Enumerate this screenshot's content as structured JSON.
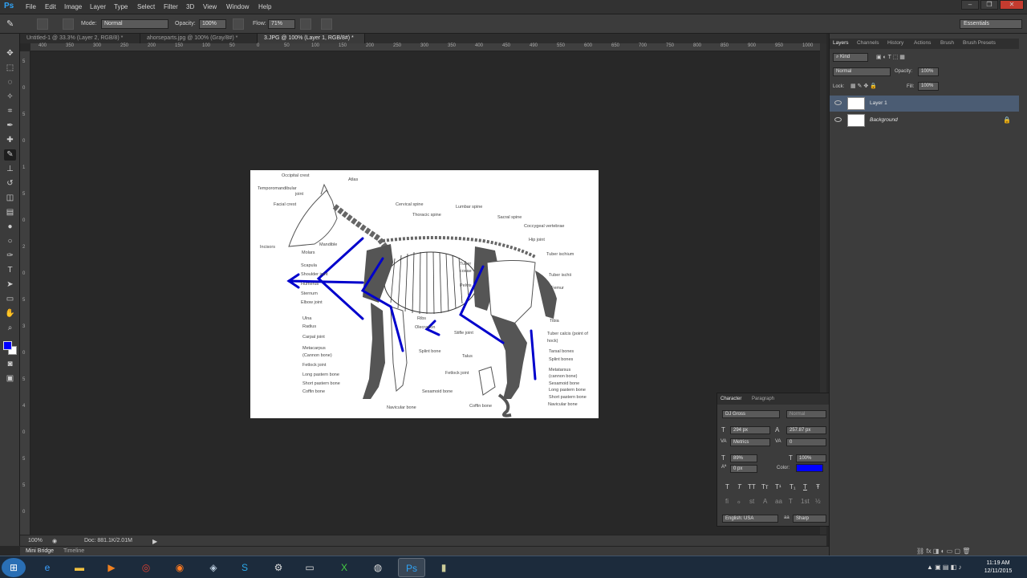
{
  "app": {
    "logo": "Ps"
  },
  "menu": [
    "File",
    "Edit",
    "Image",
    "Layer",
    "Type",
    "Select",
    "Filter",
    "3D",
    "View",
    "Window",
    "Help"
  ],
  "options": {
    "mode_label": "Mode:",
    "mode_value": "Normal",
    "opacity_label": "Opacity:",
    "opacity_value": "100%",
    "flow_label": "Flow:",
    "flow_value": "71%",
    "workspace": "Essentials"
  },
  "tabs": [
    {
      "label": "Untitled-1 @ 33.3% (Layer 2, RGB/8) *",
      "active": false
    },
    {
      "label": "ahorseparts.jpg @ 100% (Gray/8#) *",
      "active": false
    },
    {
      "label": "3.JPG @ 100% (Layer 1, RGB/8#) *",
      "active": true
    }
  ],
  "ruler_h": [
    "400",
    "350",
    "300",
    "250",
    "200",
    "150",
    "100",
    "50",
    "0",
    "50",
    "100",
    "150",
    "200",
    "250",
    "300",
    "350",
    "400",
    "450",
    "490",
    "550",
    "600",
    "650",
    "700",
    "750",
    "800",
    "850",
    "900",
    "950",
    "1000"
  ],
  "ruler_v": [
    "5",
    "0",
    "5",
    "0",
    "1",
    "5",
    "0",
    "2",
    "0",
    "5",
    "3",
    "0",
    "5",
    "4",
    "0",
    "5",
    "5",
    "0"
  ],
  "diagram_labels": [
    "Occipital crest",
    "Atlas",
    "Temporomandibular",
    "joint",
    "Facial crest",
    "Cervical spine",
    "Thoracic spine",
    "Lumbar spine",
    "Sacral spine",
    "Coccygeal vertebrae",
    "Hip joint",
    "Incisors",
    "Mandible",
    "Molars",
    "Scapula",
    "Shoulder joint",
    "Humerus",
    "Sternum",
    "Elbow joint",
    "Tuber",
    "coxae",
    "Pelvis",
    "Tuber ischium",
    "Tuber ischii",
    "Femur",
    "Ulna",
    "Radius",
    "Carpal joint",
    "Metacarpus",
    "(Cannon bone)",
    "Fetlock joint",
    "Long pastern bone",
    "Short pastern bone",
    "Coffin bone",
    "Ribs",
    "Olecranon",
    "Stifle joint",
    "Splint bone",
    "Talus",
    "Fetlock joint",
    "Sesamoid bone",
    "Navicular bone",
    "Coffin bone",
    "Tibia",
    "Tuber calcis (point of",
    "hock)",
    "Tarsal bones",
    "Splint bones",
    "Metatarsus",
    "(cannon bone)",
    "Sesamoid bone",
    "Long pastern bone",
    "Short pastern bone",
    "Navicular bone"
  ],
  "status": {
    "zoom": "100%",
    "doc": "Doc: 881.1K/2.01M"
  },
  "bottom_tabs": {
    "mini_bridge": "Mini Bridge",
    "timeline": "Timeline"
  },
  "layers_panel": {
    "tabs": [
      "Layers",
      "Channels",
      "History",
      "Actions",
      "Brush",
      "Brush Presets"
    ],
    "kind": "Kind",
    "blend": "Normal",
    "opacity_label": "Opacity:",
    "opacity_value": "100%",
    "lock_label": "Lock:",
    "fill_label": "Fill:",
    "fill_value": "100%",
    "layers": [
      {
        "name": "Layer 1",
        "selected": true
      },
      {
        "name": "Background",
        "selected": false
      }
    ]
  },
  "character_panel": {
    "tabs": [
      "Character",
      "Paragraph"
    ],
    "font_family": "DJ Gross",
    "font_style": "Normal",
    "size": "294 px",
    "leading": "257.87 px",
    "kerning": "Metrics",
    "tracking": "0",
    "vscale": "89%",
    "hscale": "100%",
    "baseline": "0 px",
    "color_label": "Color:",
    "color": "#0000ff",
    "language": "English: USA",
    "aa_label": "aa",
    "antialias": "Sharp",
    "style_buttons": [
      "T",
      "T",
      "TT",
      "Tт",
      "T¹",
      "T₁",
      "T",
      "Ŧ"
    ],
    "opentype_buttons": [
      "fi",
      "ℴ",
      "st",
      "A",
      "aa",
      "T",
      "1st",
      "½"
    ]
  },
  "clock": {
    "time": "11:19 AM",
    "date": "12/11/2015"
  }
}
